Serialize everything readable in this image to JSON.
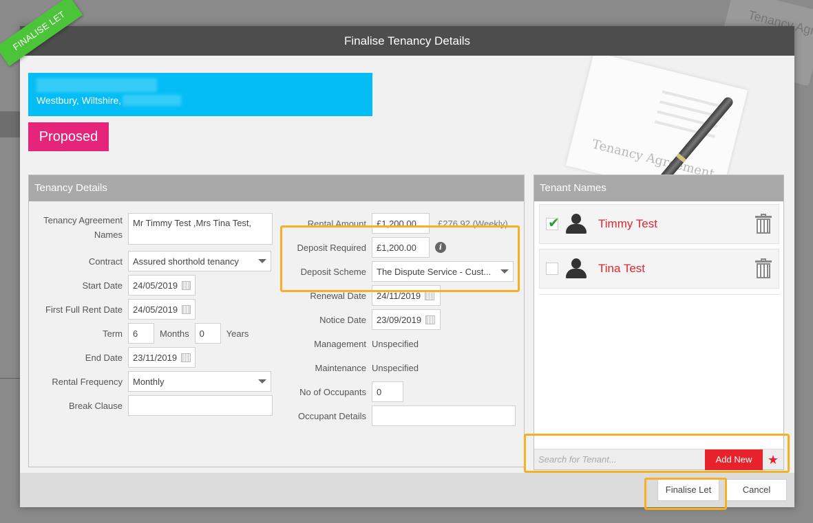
{
  "background": {
    "card_text": "Tenancy Agre"
  },
  "ribbon": {
    "label": "FINALISE LET"
  },
  "modal": {
    "title": "Finalise Tenancy Details"
  },
  "property": {
    "address_line2": "Westbury, Wiltshire,",
    "status": "Proposed"
  },
  "hero": {
    "paper_text": "Tenancy Agreement"
  },
  "tenancy": {
    "header": "Tenancy Details",
    "agreement_names_label_1": "Tenancy Agreement",
    "agreement_names_label_2": "Names",
    "agreement_names_value": "Mr Timmy Test ,Mrs Tina Test,",
    "contract_label": "Contract",
    "contract_value": "Assured shorthold tenancy",
    "start_date_label": "Start Date",
    "start_date_value": "24/05/2019",
    "first_rent_label": "First Full Rent Date",
    "first_rent_value": "24/05/2019",
    "term_label": "Term",
    "term_months_value": "6",
    "months_label": "Months",
    "term_years_value": "0",
    "years_label": "Years",
    "end_date_label": "End Date",
    "end_date_value": "23/11/2019",
    "rental_freq_label": "Rental Frequency",
    "rental_freq_value": "Monthly",
    "break_clause_label": "Break Clause",
    "break_clause_value": "",
    "rental_amount_label": "Rental Amount",
    "rental_amount_value": "£1,200.00",
    "rental_weekly": "£276.92 (Weekly)",
    "deposit_required_label": "Deposit Required",
    "deposit_required_value": "£1,200.00",
    "deposit_scheme_label": "Deposit Scheme",
    "deposit_scheme_value": "The Dispute Service - Cust...",
    "renewal_date_label": "Renewal Date",
    "renewal_date_value": "24/11/2019",
    "notice_date_label": "Notice Date",
    "notice_date_value": "23/09/2019",
    "management_label": "Management",
    "management_value": "Unspecified",
    "maintenance_label": "Maintenance",
    "maintenance_value": "Unspecified",
    "occupants_label": "No of Occupants",
    "occupants_value": "0",
    "occupant_details_label": "Occupant Details",
    "occupant_details_value": ""
  },
  "tenants": {
    "header": "Tenant Names",
    "items": [
      {
        "name": "Timmy Test",
        "checked": true
      },
      {
        "name": "Tina Test",
        "checked": false
      }
    ],
    "search_placeholder": "Search for Tenant...",
    "add_new_label": "Add New"
  },
  "footer": {
    "finalise_label": "Finalise Let",
    "cancel_label": "Cancel"
  },
  "colors": {
    "accent_blue": "#05bdf6",
    "status_pink": "#e5247a",
    "add_red": "#e8222c",
    "highlight": "#f5b023",
    "ribbon_green": "#4cc43a"
  }
}
